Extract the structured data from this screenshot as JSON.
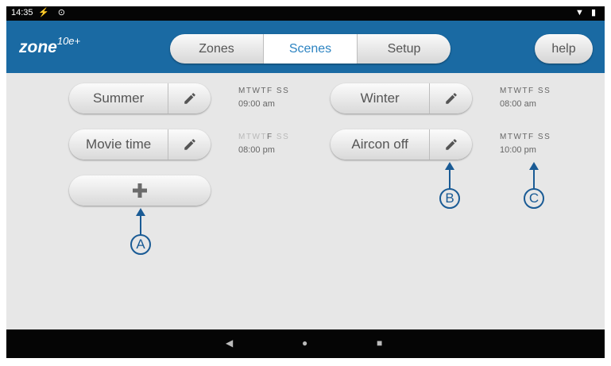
{
  "status": {
    "time": "14:35",
    "icons_left": "⚡ ⊙",
    "icons_right": "▼ ▮"
  },
  "header": {
    "brand": "zone",
    "brand_sup": "10e+",
    "tabs": [
      {
        "label": "Zones"
      },
      {
        "label": "Scenes"
      },
      {
        "label": "Setup"
      }
    ],
    "active_tab": "Scenes",
    "help_label": "help"
  },
  "scenes": [
    {
      "name": "Summer",
      "days": [
        "M",
        "T",
        "W",
        "T",
        "F",
        "S",
        "S"
      ],
      "active_days": [
        true,
        true,
        true,
        true,
        true,
        true,
        true
      ],
      "time": "09:00 am"
    },
    {
      "name": "Winter",
      "days": [
        "M",
        "T",
        "W",
        "T",
        "F",
        "S",
        "S"
      ],
      "active_days": [
        true,
        true,
        true,
        true,
        true,
        true,
        true
      ],
      "time": "08:00 am"
    },
    {
      "name": "Movie time",
      "days": [
        "M",
        "T",
        "W",
        "T",
        "F",
        "S",
        "S"
      ],
      "active_days": [
        false,
        false,
        false,
        false,
        true,
        false,
        false
      ],
      "time": "08:00 pm"
    },
    {
      "name": "Aircon off",
      "days": [
        "M",
        "T",
        "W",
        "T",
        "F",
        "S",
        "S"
      ],
      "active_days": [
        true,
        true,
        true,
        true,
        true,
        true,
        true
      ],
      "time": "10:00 pm"
    }
  ],
  "add_button": {
    "icon": "plus-icon"
  },
  "annotations": {
    "a": "A",
    "b": "B",
    "c": "C"
  },
  "colors": {
    "header": "#1a6aa3",
    "active_tab_text": "#2d84c2",
    "annotation": "#1a5b95"
  },
  "navigation": {
    "back": "◀",
    "home": "●",
    "recents": "■"
  }
}
